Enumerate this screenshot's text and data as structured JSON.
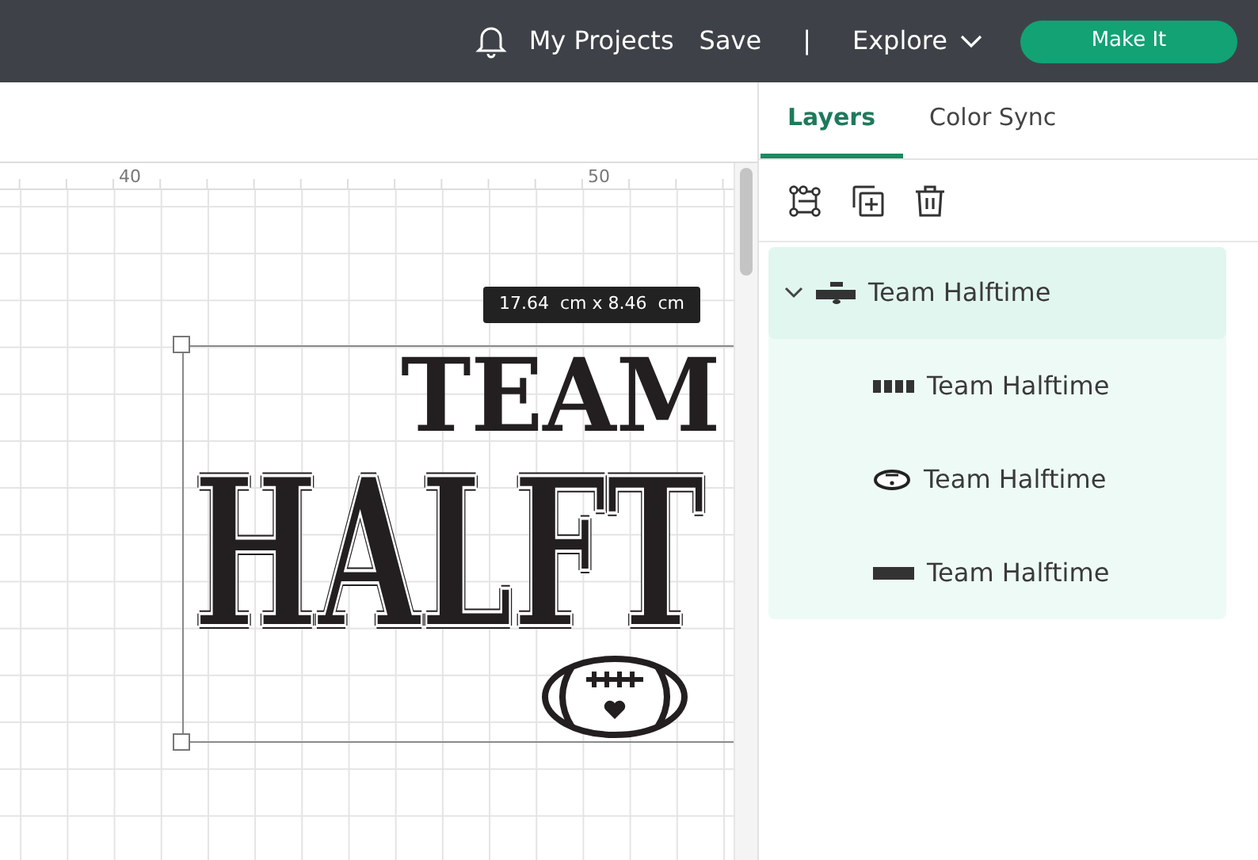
{
  "topbar": {
    "nav": [
      {
        "label": "My Projects",
        "kind": "link"
      },
      {
        "label": "Save",
        "kind": "link"
      },
      {
        "label": "|",
        "kind": "separator"
      },
      {
        "label": "Explore",
        "kind": "dropdown"
      }
    ],
    "make_it": "Make It"
  },
  "canvas": {
    "ruler_labels": [
      "40",
      "50"
    ],
    "size_label": "17.64  cm x 8.46  cm",
    "selected": true,
    "artwork": {
      "top_word": "TEAM",
      "main_word": "HALFT"
    }
  },
  "panel": {
    "tabs": [
      {
        "label": "Layers",
        "selected": true
      },
      {
        "label": "Color Sync",
        "selected": false
      }
    ],
    "layers": [
      {
        "name": "Team Halftime",
        "kind": "group",
        "expanded": true,
        "selected": true,
        "children": [
          {
            "name": "Team Halftime",
            "kind": "team",
            "selected": false
          },
          {
            "name": "Team Halftime",
            "kind": "football",
            "selected": false
          },
          {
            "name": "Team Halftime",
            "kind": "halftime",
            "selected": false
          }
        ]
      }
    ]
  }
}
